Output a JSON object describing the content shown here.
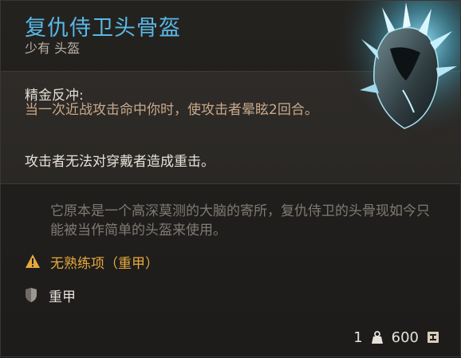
{
  "item": {
    "name": "复仇侍卫头骨盔",
    "rarity_type": "少有 头盔",
    "rarity_color": "#59b8e6"
  },
  "ability": {
    "name": "精金反冲:",
    "description": "当一次近战攻击命中你时，使攻击者晕眩2回合。",
    "passive": "攻击者无法对穿戴者造成重击。"
  },
  "flavor_text": "它原本是一个高深莫测的大脑的寄所，复仇侍卫的头骨现如今只能被当作简单的头盔来使用。",
  "proficiency": {
    "icon": "warning-icon",
    "text": "无熟练项（重甲）",
    "color": "#e6a93b"
  },
  "armor": {
    "icon": "shield-icon",
    "text": "重甲"
  },
  "footer": {
    "weight": "1",
    "weight_icon": "weight-icon",
    "price": "600",
    "price_icon": "gold-coin-icon"
  }
}
